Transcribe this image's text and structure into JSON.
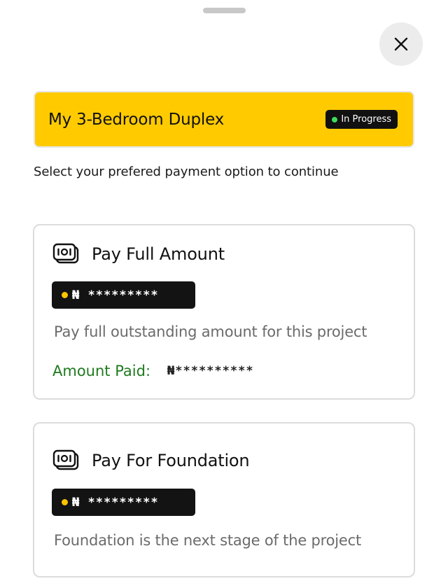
{
  "project": {
    "title": "My 3-Bedroom Duplex",
    "status": "In Progress"
  },
  "instruction": "Select your prefered payment option to continue",
  "options": [
    {
      "title": "Pay Full Amount",
      "amount": "₦ *********",
      "description": "Pay full outstanding amount for this project",
      "paid_label": "Amount Paid:",
      "paid_value": "₦**********"
    },
    {
      "title": "Pay For Foundation",
      "amount": "₦ *********",
      "description": "Foundation is the next stage of the project"
    }
  ],
  "icons": {
    "close": "close-icon",
    "cash": "cash-icon"
  },
  "colors": {
    "banner": "#ffcb00",
    "status_dot": "#3ddc5c",
    "pill_dot": "#ffc400",
    "paid_label": "#1f7a1f"
  }
}
